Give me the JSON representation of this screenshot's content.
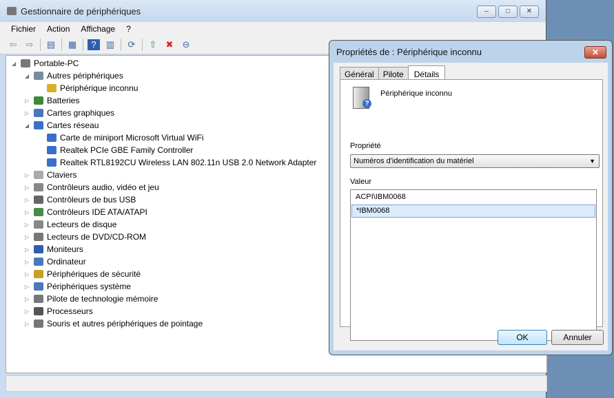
{
  "window": {
    "title": "Gestionnaire de périphériques"
  },
  "menu": [
    "Fichier",
    "Action",
    "Affichage",
    "?"
  ],
  "toolbar": [
    "back-icon",
    "forward-icon",
    "console-tree-icon",
    "properties-icon",
    "help-icon",
    "action-pane-icon",
    "scan-hardware-icon",
    "update-driver-icon",
    "uninstall-icon",
    "disable-icon"
  ],
  "tree": [
    {
      "label": "Portable-PC",
      "level": 0,
      "exp": "◢"
    },
    {
      "label": "Autres périphériques",
      "level": 1,
      "exp": "◢"
    },
    {
      "label": "Périphérique inconnu",
      "level": 2,
      "exp": ""
    },
    {
      "label": "Batteries",
      "level": 1,
      "exp": "▷"
    },
    {
      "label": "Cartes graphiques",
      "level": 1,
      "exp": "▷"
    },
    {
      "label": "Cartes réseau",
      "level": 1,
      "exp": "◢"
    },
    {
      "label": "Carte de miniport Microsoft Virtual WiFi",
      "level": 2,
      "exp": ""
    },
    {
      "label": "Realtek PCIe GBE Family Controller",
      "level": 2,
      "exp": ""
    },
    {
      "label": "Realtek RTL8192CU Wireless LAN 802.11n USB 2.0 Network Adapter",
      "level": 2,
      "exp": ""
    },
    {
      "label": "Claviers",
      "level": 1,
      "exp": "▷"
    },
    {
      "label": "Contrôleurs audio, vidéo et jeu",
      "level": 1,
      "exp": "▷"
    },
    {
      "label": "Contrôleurs de bus USB",
      "level": 1,
      "exp": "▷"
    },
    {
      "label": "Contrôleurs IDE ATA/ATAPI",
      "level": 1,
      "exp": "▷"
    },
    {
      "label": "Lecteurs de disque",
      "level": 1,
      "exp": "▷"
    },
    {
      "label": "Lecteurs de DVD/CD-ROM",
      "level": 1,
      "exp": "▷"
    },
    {
      "label": "Moniteurs",
      "level": 1,
      "exp": "▷"
    },
    {
      "label": "Ordinateur",
      "level": 1,
      "exp": "▷"
    },
    {
      "label": "Périphériques de sécurité",
      "level": 1,
      "exp": "▷"
    },
    {
      "label": "Périphériques système",
      "level": 1,
      "exp": "▷"
    },
    {
      "label": "Pilote de technologie mémoire",
      "level": 1,
      "exp": "▷"
    },
    {
      "label": "Processeurs",
      "level": 1,
      "exp": "▷"
    },
    {
      "label": "Souris et autres périphériques de pointage",
      "level": 1,
      "exp": "▷"
    }
  ],
  "dialog": {
    "title": "Propriétés de : Périphérique inconnu",
    "tabs": [
      "Général",
      "Pilote",
      "Détails"
    ],
    "device_name": "Périphérique inconnu",
    "property_label": "Propriété",
    "property_value": "Numéros d'identification du matériel",
    "value_label": "Valeur",
    "values": [
      "ACPI\\IBM0068",
      "*IBM0068"
    ],
    "ok": "OK",
    "cancel": "Annuler"
  }
}
